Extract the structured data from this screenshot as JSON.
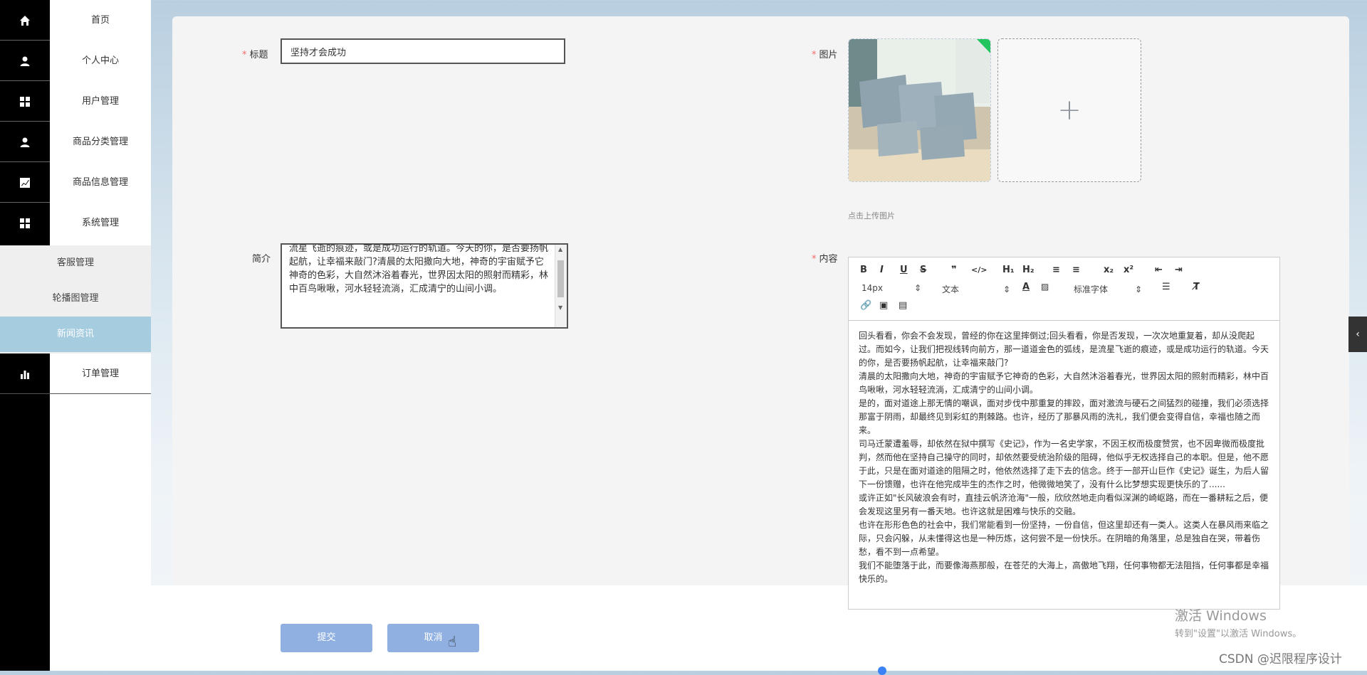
{
  "sidebar": {
    "items": [
      {
        "label": "首页",
        "icon": "home-icon"
      },
      {
        "label": "个人中心",
        "icon": "user-icon"
      },
      {
        "label": "用户管理",
        "icon": "grid-icon"
      },
      {
        "label": "商品分类管理",
        "icon": "user-icon"
      },
      {
        "label": "商品信息管理",
        "icon": "chart-line-icon"
      },
      {
        "label": "系统管理",
        "icon": "grid-icon"
      }
    ],
    "submenu": [
      {
        "label": "客服管理"
      },
      {
        "label": "轮播图管理"
      },
      {
        "label": "新闻资讯",
        "active": true
      }
    ],
    "last_item": {
      "label": "订单管理",
      "icon": "bar-chart-icon"
    }
  },
  "form": {
    "title_label": "标题",
    "title_value": "坚持才会成功",
    "image_label": "图片",
    "upload_tip": "点击上传图片",
    "summary_label": "简介",
    "summary_value": "流星飞逝的痕迹，或是成功运行的轨道。今天的你，是否要扬帆起航，让幸福来敲门?清晨的太阳撒向大地，神奇的宇宙赋予它神奇的色彩，大自然沐浴着春光，世界因太阳的照射而精彩，林中百鸟啾啾，河水轻轻流淌，汇成清宁的山间小调。",
    "content_label": "内容",
    "content_paragraphs": [
      "回头看看，你会不会发现，曾经的你在这里摔倒过;回头看看，你是否发现，一次次地重复着，却从没爬起过。而如今，让我们把视线转向前方，那一道道金色的弧线，是流星飞逝的痕迹，或是成功运行的轨道。今天的你，是否要扬帆起航，让幸福来敲门?",
      "清晨的太阳撒向大地，神奇的宇宙赋予它神奇的色彩，大自然沐浴着春光，世界因太阳的照射而精彩，林中百鸟啾啾，河水轻轻流淌，汇成清宁的山间小调。",
      "是的，面对道途上那无情的嘲讽，面对步伐中那重复的摔跤，面对激流与硬石之间猛烈的碰撞，我们必须选择那富于阴雨，却最终见到彩虹的荆棘路。也许，经历了那暴风雨的洗礼，我们便会变得自信，幸福也随之而来。",
      "司马迁蒙遭羞辱，却依然在狱中撰写《史记》，作为一名史学家，不因王权而极度赞赏，也不因卑微而极度批判，然而他在坚持自己操守的同时，却依然要受统治阶级的阻碍，他似乎无权选择自己的本职。但是，他不愿于此，只是在面对道途的阻隔之时，他依然选择了走下去的信念。终于一部开山巨作《史记》诞生，为后人留下一份馈赠，也许在他完成毕生的杰作之时，他微微地笑了，没有什么比梦想实现更快乐的了......",
      "或许正如\"长风破浪会有时，直挂云帆济沧海\"一般，欣欣然地走向看似深渊的崎岖路，而在一番耕耘之后，便会发现这里另有一番天地。也许这就是困难与快乐的交融。",
      "也许在形形色色的社会中，我们常能看到一份坚持，一份自信，但这里却还有一类人。这类人在暴风雨来临之际，只会闪躲，从未懂得这也是一种历炼，这何尝不是一份快乐。在阴暗的角落里，总是独自在哭，带着伤愁，看不到一点希望。",
      "我们不能堕落于此，而要像海燕那般，在苍茫的大海上，高傲地飞翔，任何事物都无法阻挡，任何事都是幸福快乐的。"
    ]
  },
  "editor": {
    "font_size": "14px",
    "block_type": "文本",
    "font_family": "标准字体",
    "buttons_row1": [
      "B",
      "I",
      "U",
      "S",
      "❞",
      "</>",
      "H₁",
      "H₂",
      "≡",
      "≡",
      "x₂",
      "x²",
      "⇤",
      "⇥"
    ]
  },
  "actions": {
    "submit": "提交",
    "cancel": "取消"
  },
  "overlay": {
    "activate_title": "激活 Windows",
    "activate_sub": "转到\"设置\"以激活 Windows。",
    "watermark": "CSDN @迟限程序设计"
  },
  "colors": {
    "active_menu": "#a6cce0",
    "button": "#8fb0e0",
    "required": "#f56c6c"
  }
}
